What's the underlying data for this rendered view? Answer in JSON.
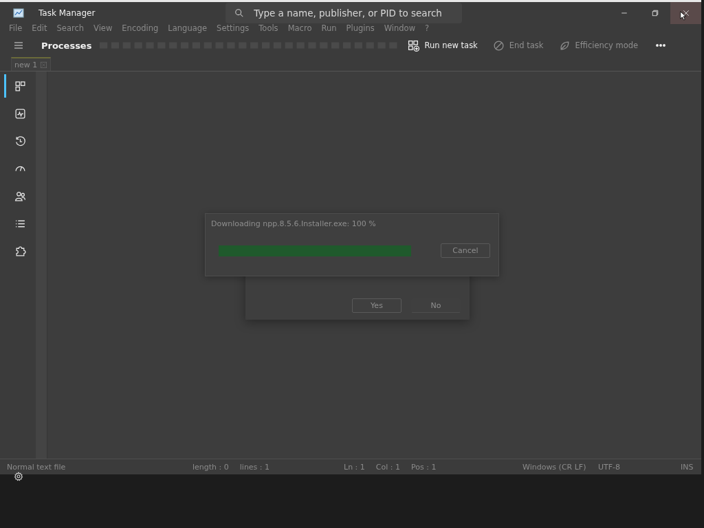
{
  "window": {
    "title": "Task Manager",
    "search": {
      "placeholder": "Type a name, publisher, or PID to search"
    }
  },
  "background_menu": [
    "File",
    "Edit",
    "Search",
    "View",
    "Encoding",
    "Language",
    "Settings",
    "Tools",
    "Macro",
    "Run",
    "Plugins",
    "Window",
    "?"
  ],
  "command_bar": {
    "page_title": "Processes",
    "commands": [
      {
        "kind": "run",
        "label": "Run new task",
        "disabled": false
      },
      {
        "kind": "end",
        "label": "End task",
        "disabled": true
      },
      {
        "kind": "efficiency",
        "label": "Efficiency mode",
        "disabled": true
      }
    ]
  },
  "editor_tabs": [
    {
      "label": "new 1",
      "selected": true
    }
  ],
  "sidebar": {
    "items": [
      {
        "kind": "processes",
        "selected": true
      },
      {
        "kind": "performance",
        "selected": false
      },
      {
        "kind": "history",
        "selected": false
      },
      {
        "kind": "startup",
        "selected": false
      },
      {
        "kind": "users",
        "selected": false
      },
      {
        "kind": "details",
        "selected": false
      },
      {
        "kind": "services",
        "selected": false
      }
    ]
  },
  "download_dialog": {
    "message": "Downloading npp.8.5.6.Installer.exe: 100 %",
    "level": 1.0,
    "button": "Cancel"
  },
  "confirm_dialog": {
    "buttons": [
      "Yes",
      "No"
    ]
  },
  "status_bar": [
    [
      "Normal text file"
    ],
    [
      "length : 0",
      "lines : 1"
    ],
    [
      "Ln : 1",
      "Col : 1",
      "Pos : 1"
    ],
    [
      "Windows (CR LF)"
    ],
    [
      "UTF-8"
    ],
    [
      "INS"
    ]
  ]
}
